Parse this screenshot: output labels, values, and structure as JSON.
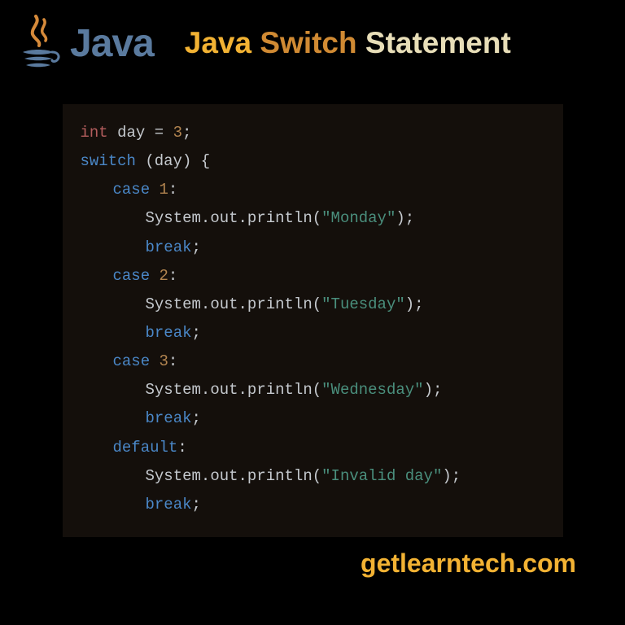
{
  "logo_text": "Java",
  "title": {
    "w1": "Java",
    "w2": "Switch",
    "w3": "Statement"
  },
  "code": {
    "l1": {
      "kw": "int",
      "id": "day",
      "eq": "=",
      "val": "3",
      "sc": ";"
    },
    "l2": {
      "kw": "switch",
      "op": "(",
      "id": "day",
      "cp": ")",
      "ob": "{"
    },
    "case1": {
      "kw": "case",
      "val": "1",
      "co": ":"
    },
    "p1": {
      "obj": "System.out.println(",
      "str": "\"Monday\"",
      "end": ");"
    },
    "b1": {
      "kw": "break",
      "sc": ";"
    },
    "case2": {
      "kw": "case",
      "val": "2",
      "co": ":"
    },
    "p2": {
      "obj": "System.out.println(",
      "str": "\"Tuesday\"",
      "end": ");"
    },
    "b2": {
      "kw": "break",
      "sc": ";"
    },
    "case3": {
      "kw": "case",
      "val": "3",
      "co": ":"
    },
    "p3": {
      "obj": "System.out.println(",
      "str": "\"Wednesday\"",
      "end": ");"
    },
    "b3": {
      "kw": "break",
      "sc": ";"
    },
    "def": {
      "kw": "default",
      "co": ":"
    },
    "p4": {
      "obj": "System.out.println(",
      "str": "\"Invalid day\"",
      "end": ");"
    },
    "b4": {
      "kw": "break",
      "sc": ";"
    }
  },
  "footer": "getlearntech.com"
}
